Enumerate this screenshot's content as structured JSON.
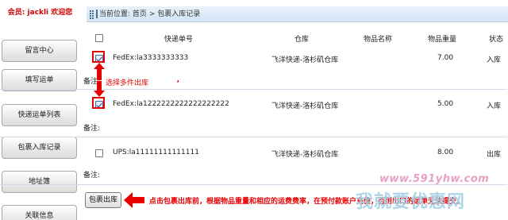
{
  "sidebar": {
    "welcome_prefix": "会员:",
    "welcome_user": "jackli",
    "welcome_suffix": "欢迎您",
    "items": [
      {
        "label": "留言中心"
      },
      {
        "label": "填写运单"
      },
      {
        "label": "快递运单列表"
      },
      {
        "label": "包裹入库记录"
      },
      {
        "label": "地址簿"
      },
      {
        "label": "关联信息"
      }
    ]
  },
  "breadcrumb": {
    "prefix": "当前位置:",
    "home": "首页",
    "separator": ">",
    "current": "包裹入库记录"
  },
  "table": {
    "headers": {
      "tracking": "快递单号",
      "warehouse": "仓库",
      "item_name": "物品名称",
      "weight": "物品重量",
      "status": "状态"
    },
    "rows": [
      {
        "tracking": "FedEx:la3333333333",
        "warehouse": "飞洋快递-洛杉矶仓库",
        "item_name": "",
        "weight": "7.00",
        "status": "入库",
        "checked": true
      },
      {
        "tracking": "FedEx:la1222222222222222222",
        "warehouse": "飞洋快递-洛杉矶仓库",
        "item_name": "",
        "weight": "5.00",
        "status": "入库",
        "checked": true
      },
      {
        "tracking": "UPS:la11111111111111",
        "warehouse": "飞洋快递-洛杉矶仓库",
        "item_name": "",
        "weight": "8.00",
        "status": "出库",
        "checked": false
      }
    ],
    "note_label": "备注:"
  },
  "actions": {
    "submit_label": "包裹出库"
  },
  "annotations": {
    "select_hint": "选择多件出库",
    "comma": "，",
    "bottom_hint": "点击包裹出库前，根据物品重量和相应的运费费率，在预付款账户充值，否则出口的运单无法提交。",
    "watermark_url": "www.591yhw.com",
    "watermark_brand": "我就要优惠网"
  },
  "colors": {
    "accent_red": "#e60000",
    "header_blue": "#d3e4f4",
    "divider": "#cfdbe8"
  }
}
